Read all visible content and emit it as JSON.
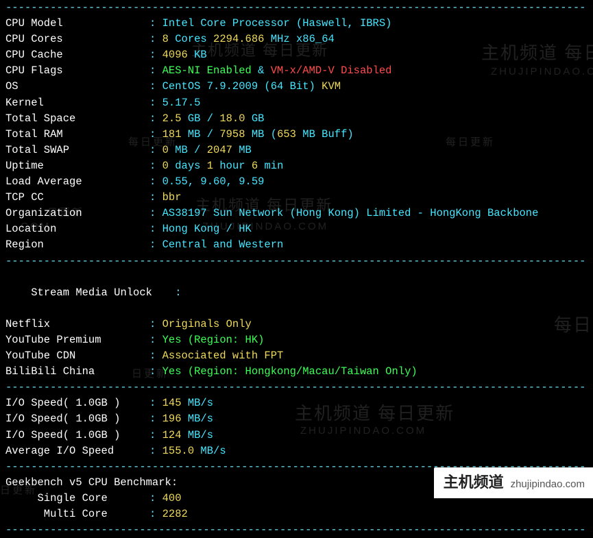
{
  "separators": {
    "dash": "----------------------------------------------------------------------------------------------"
  },
  "sys": [
    {
      "label": "CPU Model",
      "value": "Intel Core Processor (Haswell, IBRS)",
      "class": "cyan"
    },
    {
      "label": "CPU Cores",
      "value_parts": [
        {
          "t": "8",
          "c": "yellow"
        },
        {
          "t": " Cores ",
          "c": "cyan"
        },
        {
          "t": "2294.686",
          "c": "yellow"
        },
        {
          "t": " MHz ",
          "c": "cyan"
        },
        {
          "t": "x86_64",
          "c": "cyan"
        }
      ]
    },
    {
      "label": "CPU Cache",
      "value_parts": [
        {
          "t": "4096",
          "c": "yellow"
        },
        {
          "t": " KB",
          "c": "cyan"
        }
      ]
    },
    {
      "label": "CPU Flags",
      "value_parts": [
        {
          "t": "AES-NI Enabled",
          "c": "green"
        },
        {
          "t": " & ",
          "c": "cyan"
        },
        {
          "t": "VM-x/AMD-V Disabled",
          "c": "red"
        }
      ]
    },
    {
      "label": "OS",
      "value_parts": [
        {
          "t": "CentOS 7.9.2009 (64 Bit) ",
          "c": "cyan"
        },
        {
          "t": "KVM",
          "c": "yellow"
        }
      ]
    },
    {
      "label": "Kernel",
      "value": "5.17.5",
      "class": "cyan"
    },
    {
      "label": "Total Space",
      "value_parts": [
        {
          "t": "2.5",
          "c": "yellow"
        },
        {
          "t": " GB / ",
          "c": "cyan"
        },
        {
          "t": "18.0",
          "c": "yellow"
        },
        {
          "t": " GB",
          "c": "cyan"
        }
      ]
    },
    {
      "label": "Total RAM",
      "value_parts": [
        {
          "t": "181",
          "c": "yellow"
        },
        {
          "t": " MB / ",
          "c": "cyan"
        },
        {
          "t": "7958",
          "c": "yellow"
        },
        {
          "t": " MB (",
          "c": "cyan"
        },
        {
          "t": "653",
          "c": "yellow"
        },
        {
          "t": " MB Buff)",
          "c": "cyan"
        }
      ]
    },
    {
      "label": "Total SWAP",
      "value_parts": [
        {
          "t": "0",
          "c": "yellow"
        },
        {
          "t": " MB / ",
          "c": "cyan"
        },
        {
          "t": "2047",
          "c": "yellow"
        },
        {
          "t": " MB",
          "c": "cyan"
        }
      ]
    },
    {
      "label": "Uptime",
      "value_parts": [
        {
          "t": "0",
          "c": "yellow"
        },
        {
          "t": " days ",
          "c": "cyan"
        },
        {
          "t": "1",
          "c": "yellow"
        },
        {
          "t": " hour ",
          "c": "cyan"
        },
        {
          "t": "6",
          "c": "yellow"
        },
        {
          "t": " min",
          "c": "cyan"
        }
      ]
    },
    {
      "label": "Load Average",
      "value": "0.55, 9.60, 9.59",
      "class": "cyan"
    },
    {
      "label": "TCP CC",
      "value": "bbr",
      "class": "yellow"
    },
    {
      "label": "Organization",
      "value": "AS38197 Sun Network (Hong Kong) Limited - HongKong Backbone",
      "class": "cyan"
    },
    {
      "label": "Location",
      "value": "Hong Kong / HK",
      "class": "cyan"
    },
    {
      "label": "Region",
      "value": "Central and Western",
      "class": "cyan"
    }
  ],
  "stream_header": "Stream Media Unlock",
  "stream": [
    {
      "label": "Netflix",
      "value": "Originals Only",
      "class": "yellow"
    },
    {
      "label": "YouTube Premium",
      "value": "Yes (Region: HK)",
      "class": "green"
    },
    {
      "label": "YouTube CDN",
      "value": "Associated with FPT",
      "class": "yellow"
    },
    {
      "label": "BiliBili China",
      "value": "Yes (Region: Hongkong/Macau/Taiwan Only)",
      "class": "green"
    }
  ],
  "io": [
    {
      "label": "I/O Speed( 1.0GB )",
      "value_parts": [
        {
          "t": "145",
          "c": "yellow"
        },
        {
          "t": " MB/s",
          "c": "cyan"
        }
      ]
    },
    {
      "label": "I/O Speed( 1.0GB )",
      "value_parts": [
        {
          "t": "196",
          "c": "yellow"
        },
        {
          "t": " MB/s",
          "c": "cyan"
        }
      ]
    },
    {
      "label": "I/O Speed( 1.0GB )",
      "value_parts": [
        {
          "t": "124",
          "c": "yellow"
        },
        {
          "t": " MB/s",
          "c": "cyan"
        }
      ]
    },
    {
      "label": "Average I/O Speed",
      "value_parts": [
        {
          "t": "155.0",
          "c": "yellow"
        },
        {
          "t": " MB/s",
          "c": "cyan"
        }
      ]
    }
  ],
  "geek_header": "Geekbench v5 CPU Benchmark:",
  "geek": [
    {
      "label": "Single Core",
      "value": "400",
      "class": "yellow",
      "indent": "     "
    },
    {
      "label": "Multi Core",
      "value": "2282",
      "class": "yellow",
      "indent": "      "
    }
  ],
  "watermarks": {
    "big": "主机频道 每日更新",
    "url": "ZHUJIPINDAO.COM",
    "small": "每日更新",
    "small2": "日更新"
  },
  "footer": {
    "zh": "主机频道",
    "dom": "zhujipindao.com"
  }
}
